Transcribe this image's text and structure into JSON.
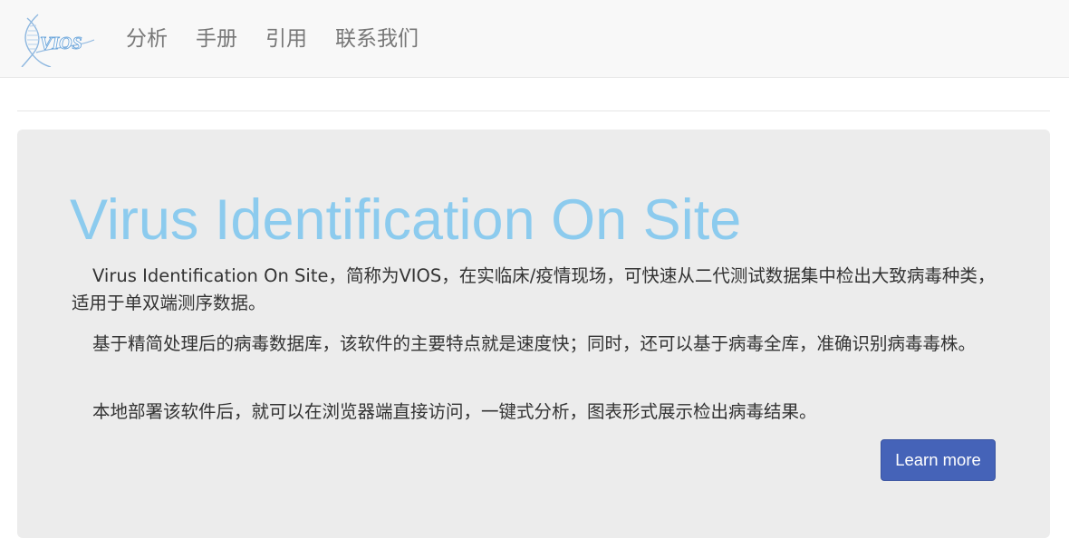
{
  "brand": {
    "logo_text": "VIOS",
    "logo_icon": "dna-helix-icon",
    "colors": {
      "logo_blue": "#6fa8dc"
    }
  },
  "nav": {
    "items": [
      {
        "label": "分析"
      },
      {
        "label": "手册"
      },
      {
        "label": "引用"
      },
      {
        "label": "联系我们"
      }
    ]
  },
  "hero": {
    "title": "Virus Identification On Site",
    "paragraphs": [
      "Virus Identification On Site，简称为VIOS，在实临床/疫情现场，可快速从二代测试数据集中检出大致病毒种类，适用于单双端测序数据。",
      "基于精简处理后的病毒数据库，该软件的主要特点就是速度快；同时，还可以基于病毒全库，准确识别病毒毒株。",
      "本地部署该软件后，就可以在浏览器端直接访问，一键式分析，图表形式展示检出病毒结果。"
    ],
    "button_label": "Learn more"
  },
  "colors": {
    "title": "#8ccbee",
    "button_bg": "#4563b8",
    "panel_bg": "#ececec",
    "navbar_bg": "#f8f8f8",
    "nav_text": "#777777"
  }
}
